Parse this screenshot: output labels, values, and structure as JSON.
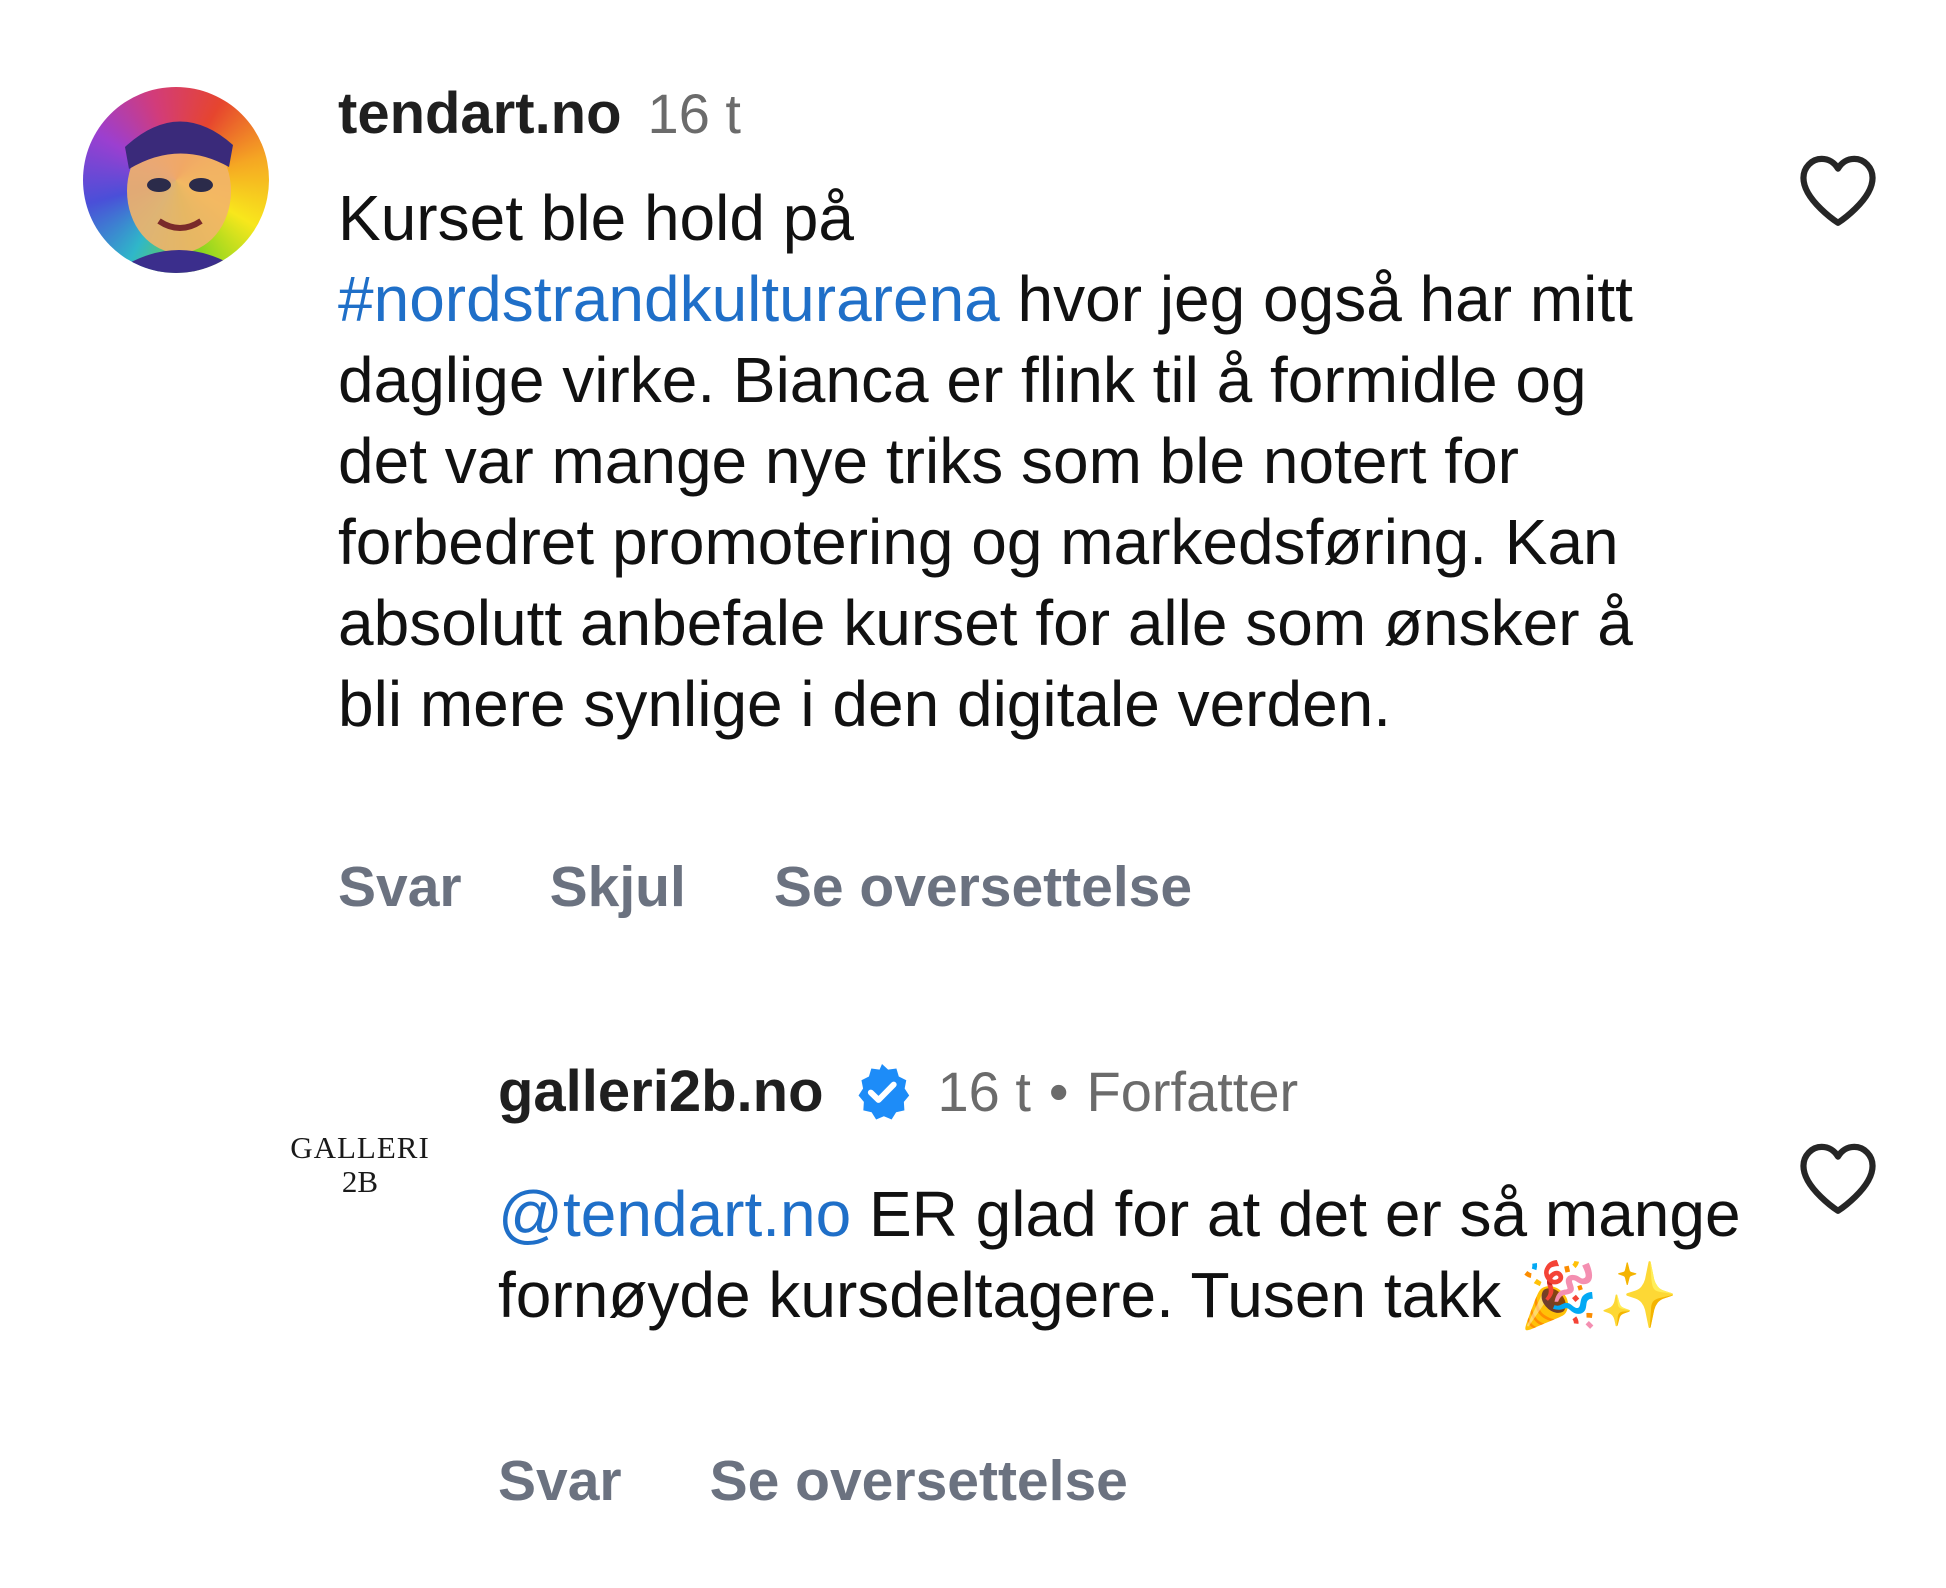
{
  "comments": [
    {
      "username": "tendart.no",
      "time": "16 t",
      "text_prefix": "Kurset ble hold på ",
      "hashtag": "#nordstrandkulturarena",
      "text_suffix": " hvor jeg også har mitt daglige virke. Bianca er flink til å formidle og det var mange nye triks som ble notert for forbedret promotering og markedsføring. Kan absolutt anbefale kurset for alle som ønsker å bli mere synlige i den digitale verden.",
      "actions": [
        "Svar",
        "Skjul",
        "Se oversettelse"
      ]
    },
    {
      "username": "galleri2b.no",
      "time": "16 t",
      "separator": "•",
      "author_label": "Forfatter",
      "mention": "@tendart.no",
      "text": " ER glad for at det er så mange fornøyde kursdeltagere. Tusen takk 🎉✨",
      "logo_line1": "GALLERI",
      "logo_line2": "2B",
      "actions": [
        "Svar",
        "Se oversettelse"
      ]
    }
  ],
  "icons": {
    "like": "heart-outline-icon",
    "verified": "verified-badge-icon"
  },
  "colors": {
    "link": "#1f6fc8",
    "verified": "#1d8cf8",
    "secondary_text": "#6b7280"
  }
}
